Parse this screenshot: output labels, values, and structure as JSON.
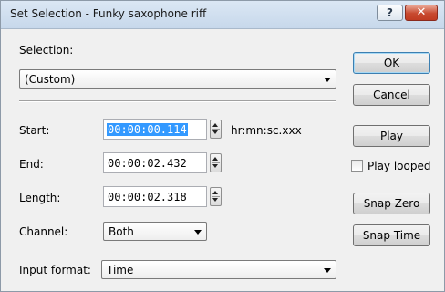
{
  "window": {
    "title": "Set Selection - Funky saxophone riff",
    "help_label": "?",
    "close_label": "✕"
  },
  "selection": {
    "label": "Selection:",
    "value": "(Custom)"
  },
  "fields": {
    "start_label": "Start:",
    "start_value": "00:00:00.114",
    "start_unit": "hr:mn:sc.xxx",
    "end_label": "End:",
    "end_value": "00:00:02.432",
    "length_label": "Length:",
    "length_value": "00:00:02.318"
  },
  "channel": {
    "label": "Channel:",
    "value": "Both"
  },
  "input_format": {
    "label": "Input format:",
    "value": "Time"
  },
  "buttons": {
    "ok": "OK",
    "cancel": "Cancel",
    "play": "Play",
    "play_looped": "Play looped",
    "snap_zero": "Snap Zero",
    "snap_time": "Snap Time"
  },
  "play_looped_checked": false,
  "colors": {
    "selection_highlight": "#3399ff",
    "close_button": "#c8492f",
    "dialog_background": "#f0f0f0"
  }
}
